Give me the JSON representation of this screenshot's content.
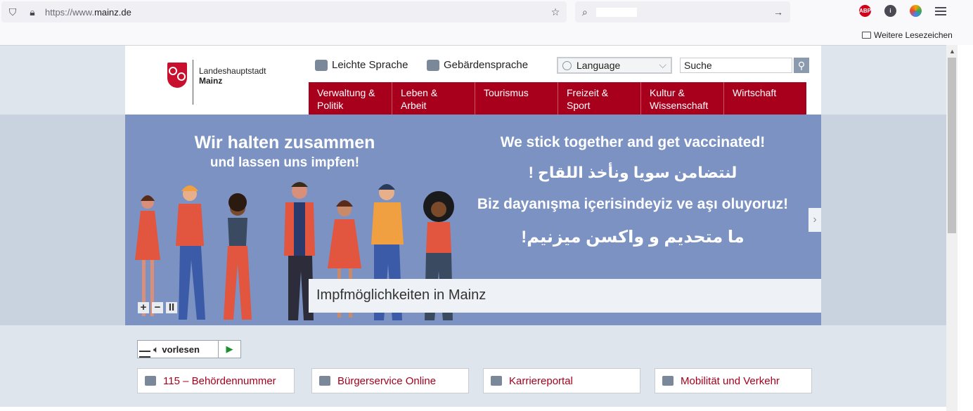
{
  "browser": {
    "url_scheme": "https://www.",
    "url_host": "mainz.de",
    "bookmarks_label": "Weitere Lesezeichen",
    "extensions": [
      {
        "name": "adblock-plus-icon",
        "label": "ABP",
        "color": "#d0021b"
      },
      {
        "name": "info-extension-icon",
        "label": "i",
        "color": "#4a4a55"
      },
      {
        "name": "colorful-extension-icon",
        "label": "",
        "color": "#f2a500"
      }
    ]
  },
  "site": {
    "logo": {
      "line1": "Landeshauptstadt",
      "line2": "Mainz"
    },
    "utility": {
      "easy_language": "Leichte Sprache",
      "sign_language": "Gebärdensprache",
      "language_select": "Language",
      "search_value": "Suche"
    },
    "nav": [
      "Verwaltung &\nPolitik",
      "Leben &\nArbeit",
      "Tourismus",
      "Freizeit &\nSport",
      "Kultur &\nWissenschaft",
      "Wirtschaft"
    ],
    "slider": {
      "headline_de_1": "Wir halten zusammen",
      "headline_de_2": "und lassen uns impfen!",
      "line_en": "We stick together and get vaccinated!",
      "line_ar": "لنتضامن سويا ونأخذ اللقاح !",
      "line_tr": "Biz dayanışma içerisindeyiz ve aşı oluyoruz!",
      "line_fa": "ما متحدیم و واکسن میزنیم!",
      "caption": "Impfmöglichkeiten in Mainz",
      "controls": [
        "+",
        "−",
        "II"
      ]
    },
    "readspeaker_label": "vorlesen",
    "quicklinks": [
      "115 – Behördennummer",
      "Bürgerservice Online",
      "Karriereportal",
      "Mobilität und Verkehr"
    ],
    "colors": {
      "brand_red": "#a8001c",
      "slide_blue": "#7b92c3"
    }
  }
}
